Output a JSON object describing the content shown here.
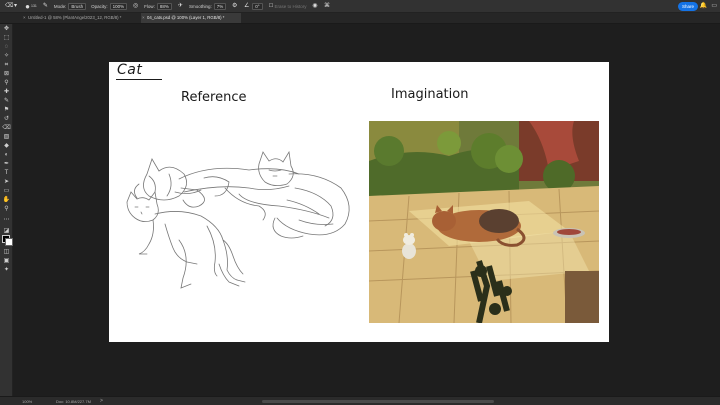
{
  "options_bar": {
    "brush_size": "131",
    "mode_label": "Mode:",
    "mode_value": "Brush",
    "opacity_label": "Opacity:",
    "opacity_value": "100%",
    "flow_label": "Flow:",
    "flow_value": "88%",
    "smoothing_label": "Smoothing:",
    "smoothing_value": "7%",
    "angle_value": "0°",
    "erase_to_history_label": "Erase to History",
    "share_label": "Share"
  },
  "tabs": [
    {
      "label": "Untitled-1 @ 58% (PlantAngel2023_12, RGB/8) *"
    },
    {
      "label": "04_cats.psd @ 100% (Layer 1, RGB/8) *"
    }
  ],
  "document": {
    "title": "Cat",
    "reference_label": "Reference",
    "imagination_label": "Imagination"
  },
  "status": {
    "zoom": "100%",
    "doc_info": "Doc: 10.8M/227.7M",
    "arrow": ">"
  },
  "colors": {
    "accent": "#1473e6",
    "panel": "#323232",
    "canvas_bg": "#1e1e1e"
  }
}
